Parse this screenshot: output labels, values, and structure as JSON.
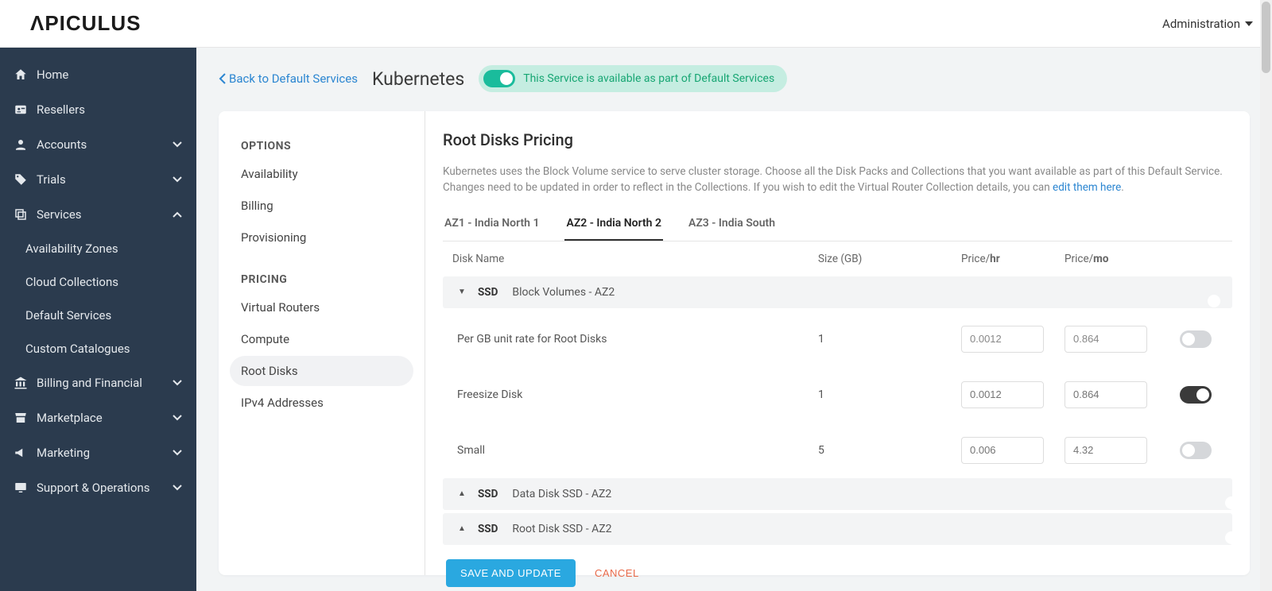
{
  "header": {
    "brand": "ΛPICULUS",
    "admin": "Administration"
  },
  "sidebar": {
    "home": "Home",
    "resellers": "Resellers",
    "accounts": "Accounts",
    "trials": "Trials",
    "services": "Services",
    "availability_zones": "Availability Zones",
    "cloud_collections": "Cloud Collections",
    "default_services": "Default Services",
    "custom_catalogues": "Custom Catalogues",
    "billing": "Billing and Financial",
    "marketplace": "Marketplace",
    "marketing": "Marketing",
    "support": "Support & Operations"
  },
  "page": {
    "back": "Back to Default Services",
    "title": "Kubernetes",
    "banner": "This Service is available as part of Default Services"
  },
  "left": {
    "options_title": "OPTIONS",
    "availability": "Availability",
    "billing": "Billing",
    "provisioning": "Provisioning",
    "pricing_title": "PRICING",
    "virtual_routers": "Virtual Routers",
    "compute": "Compute",
    "root_disks": "Root Disks",
    "ipv4": "IPv4 Addresses"
  },
  "content": {
    "heading": "Root Disks Pricing",
    "desc_prefix": "Kubernetes uses the Block Volume service to serve cluster storage. Choose all the Disk Packs and Collections that you want available as part of this Default Service. Changes need to be updated in order to reflect in the Collections. If you wish to edit the Virtual Router Collection details, you can ",
    "desc_link": "edit them here",
    "desc_suffix": ".",
    "tabs": {
      "t1": "AZ1 - India North 1",
      "t2": "AZ2 - India North 2",
      "t3": "AZ3 - India South"
    },
    "columns": {
      "name": "Disk Name",
      "size": "Size (GB)",
      "pricehr_prefix": "Price/",
      "hr": "hr",
      "pricemo_prefix": "Price/",
      "mo": "mo"
    },
    "groups": {
      "g1": {
        "tag": "SSD",
        "name": "Block Volumes - AZ2"
      },
      "g2": {
        "tag": "SSD",
        "name": "Data Disk SSD - AZ2"
      },
      "g3": {
        "tag": "SSD",
        "name": "Root Disk SSD - AZ2"
      }
    },
    "rows": {
      "r1": {
        "name": "Per GB unit rate for Root Disks",
        "size": "1",
        "hr": "0.0012",
        "mo": "0.864"
      },
      "r2": {
        "name": "Freesize Disk",
        "size": "1",
        "hr": "0.0012",
        "mo": "0.864"
      },
      "r3": {
        "name": "Small",
        "size": "5",
        "hr": "0.006",
        "mo": "4.32"
      }
    },
    "actions": {
      "save": "SAVE AND UPDATE",
      "cancel": "CANCEL"
    }
  }
}
